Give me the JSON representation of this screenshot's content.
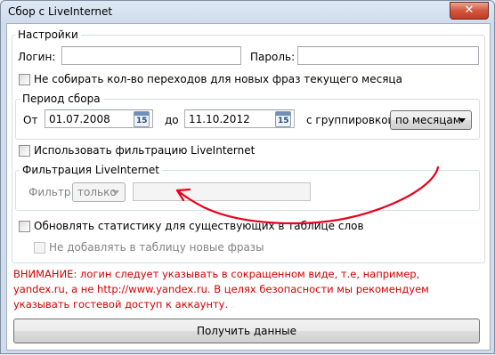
{
  "window": {
    "title": "Сбор с LiveInternet",
    "close_glyph": "✕"
  },
  "settings": {
    "legend": "Настройки",
    "login_label": "Логин:",
    "login_value": "",
    "password_label": "Пароль:",
    "password_value": "",
    "skip_current_month_label": "Не собирать кол-во переходов для новых фраз текущего месяца"
  },
  "period": {
    "legend": "Период сбора",
    "from_label": "От",
    "from_value": "01.07.2008",
    "to_label": "до",
    "to_value": "11.10.2012",
    "calendar_day": "15",
    "grouping_label": "с группировкой",
    "grouping_value": "по месяцам"
  },
  "filtering": {
    "use_label": "Использовать фильтрацию LiveInternet",
    "legend": "Фильтрация LiveInternet",
    "filter_label": "Фильтр",
    "filter_mode": "только",
    "filter_value": ""
  },
  "update": {
    "update_label": "Обновлять статистику для существующих в таблице слов",
    "no_add_label": "Не добавлять в таблицу новые фразы"
  },
  "warning": {
    "text": "ВНИМАНИЕ: логин следует указывать в сокращенном виде, т.е, например, yandex.ru, а не http://www.yandex.ru. В целях безопасности мы рекомендуем указывать гостевой доступ к аккаунту."
  },
  "actions": {
    "get_data_label": "Получить данные"
  },
  "colors": {
    "warning": "#d40000",
    "annotation_arrow": "#e8001c",
    "close_button": "#c33b21"
  }
}
